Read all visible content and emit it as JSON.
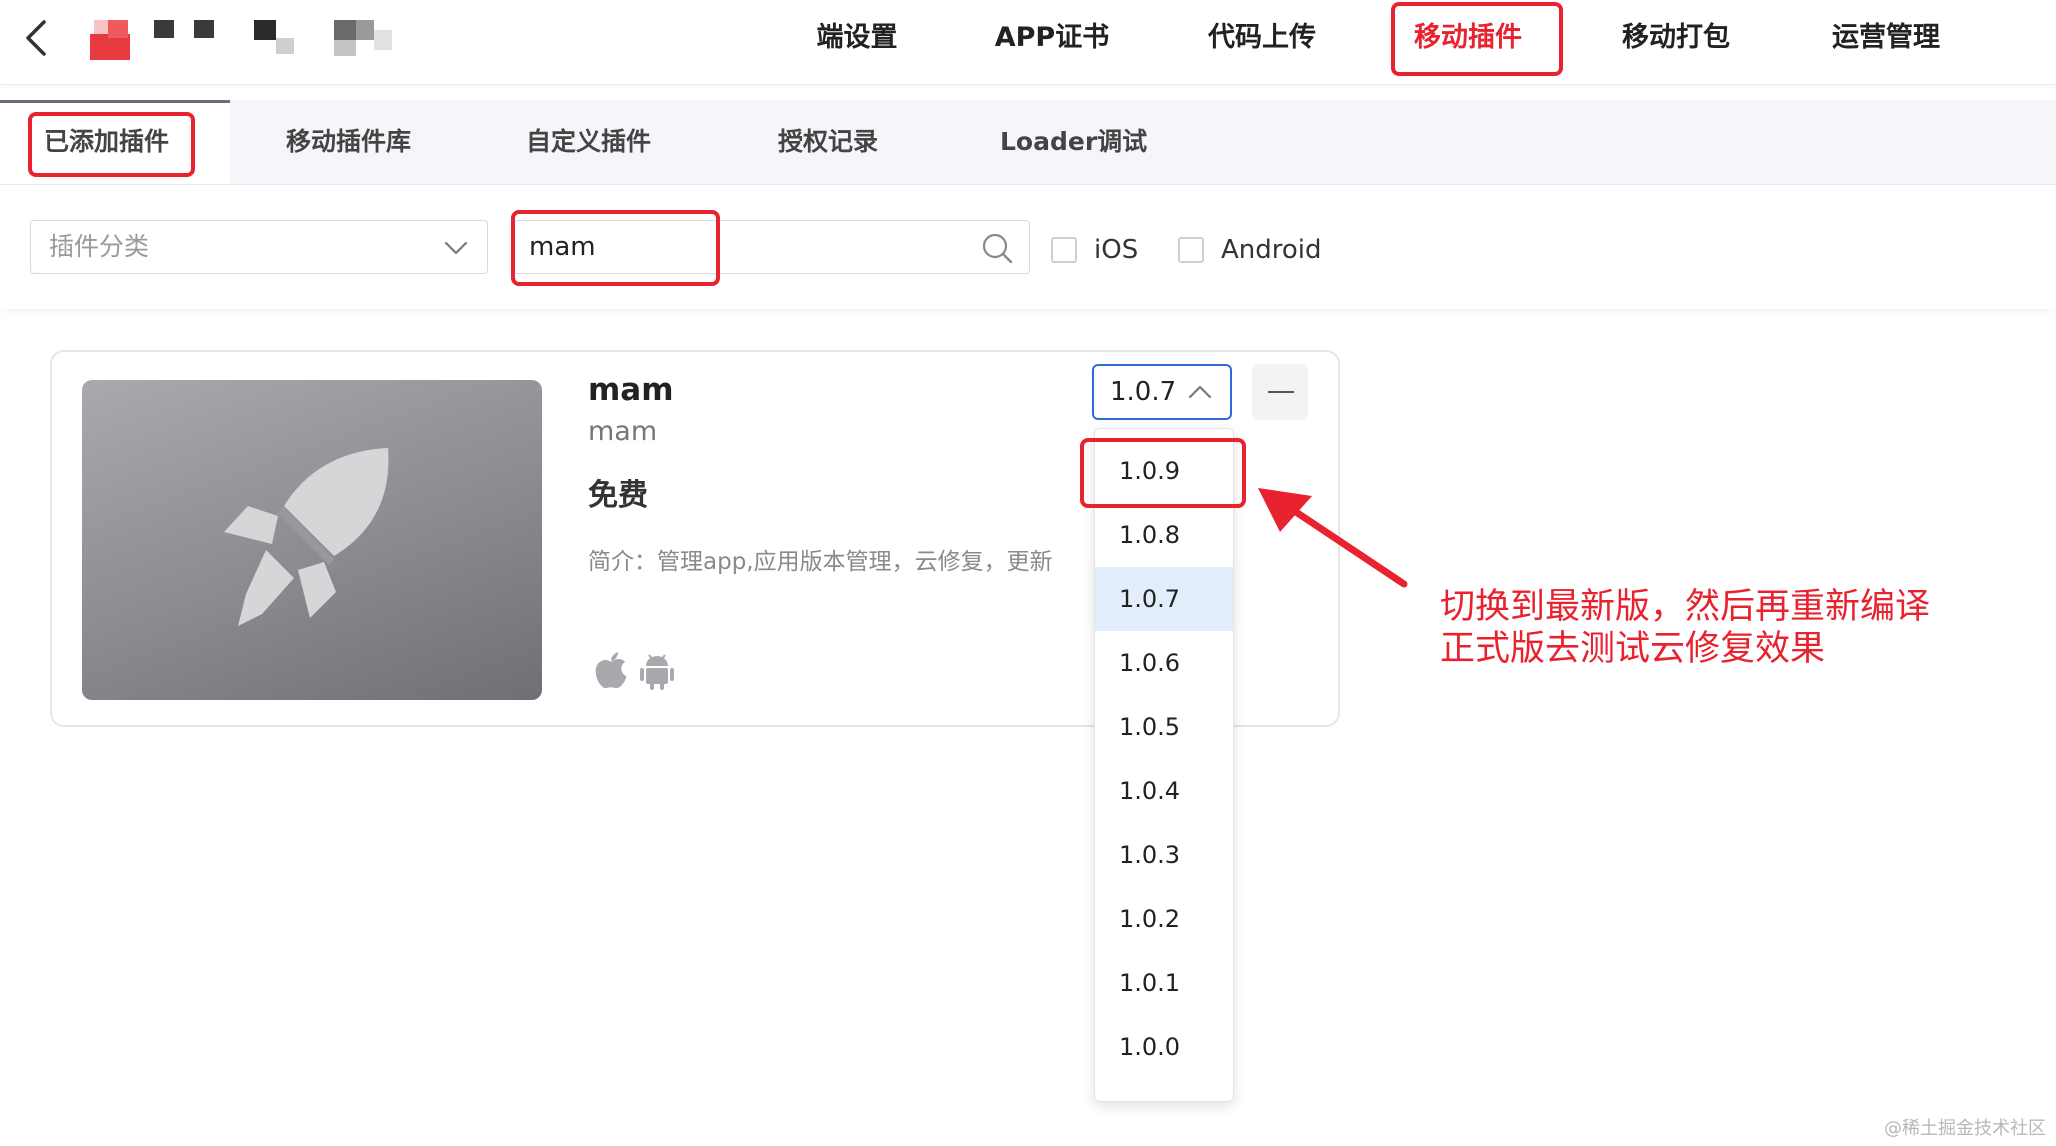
{
  "nav": {
    "items": [
      "端设置",
      "APP证书",
      "代码上传",
      "移动插件",
      "移动打包",
      "运营管理"
    ],
    "active": "移动插件",
    "back_icon": "chevron-left-icon"
  },
  "subtabs": [
    "已添加插件",
    "移动插件库",
    "自定义插件",
    "授权记录",
    "Loader调试"
  ],
  "filters": {
    "category_placeholder": "插件分类",
    "search_value": "mam",
    "ios_label": "iOS",
    "android_label": "Android"
  },
  "plugin": {
    "name": "mam",
    "id": "mam",
    "price": "免费",
    "desc": "简介：管理app,应用版本管理，云修复，更新",
    "version": "1.0.7",
    "platform_icons": [
      "apple-icon",
      "android-icon"
    ]
  },
  "versions": [
    "1.0.9",
    "1.0.8",
    "1.0.7",
    "1.0.6",
    "1.0.5",
    "1.0.4",
    "1.0.3",
    "1.0.2",
    "1.0.1",
    "1.0.0"
  ],
  "annotation": {
    "line1": "切换到最新版，然后再重新编译",
    "line2": "正式版去测试云修复效果"
  },
  "watermark": "@稀土掘金技术社区",
  "colors": {
    "highlight": "#e8232f",
    "focus": "#2f6bd8",
    "selected_option": "#e3eefc"
  }
}
